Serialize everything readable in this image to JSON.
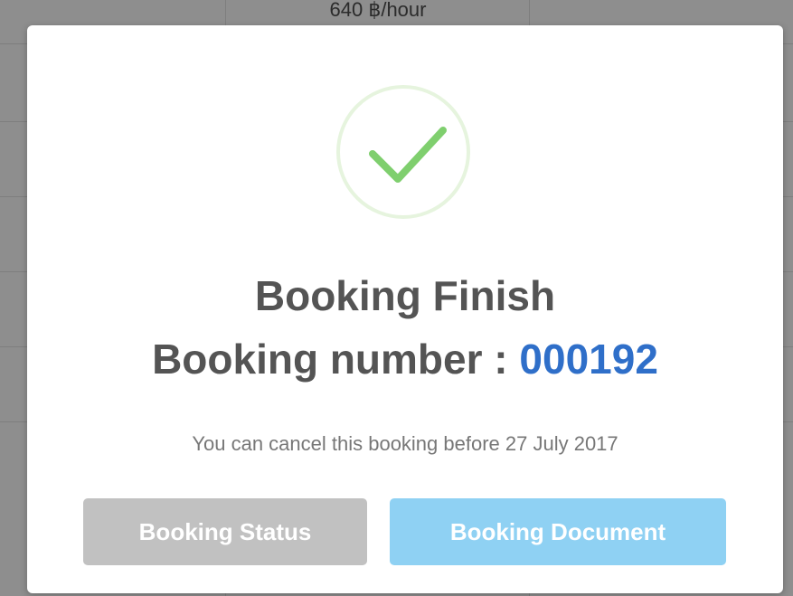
{
  "background": {
    "price_text": "640 ฿/hour"
  },
  "modal": {
    "icon": "checkmark-icon",
    "title": "Booking Finish",
    "booking_label": "Booking number : ",
    "booking_number": "000192",
    "cancel_note": "You can cancel this booking before 27 July 2017",
    "buttons": {
      "status_label": "Booking Status",
      "document_label": "Booking Document"
    }
  },
  "colors": {
    "accent_number": "#2f6fc9",
    "check_green": "#7fcf6e",
    "status_button": "#c1c1c1",
    "document_button": "#8fd1f3",
    "title_text": "#545454"
  }
}
